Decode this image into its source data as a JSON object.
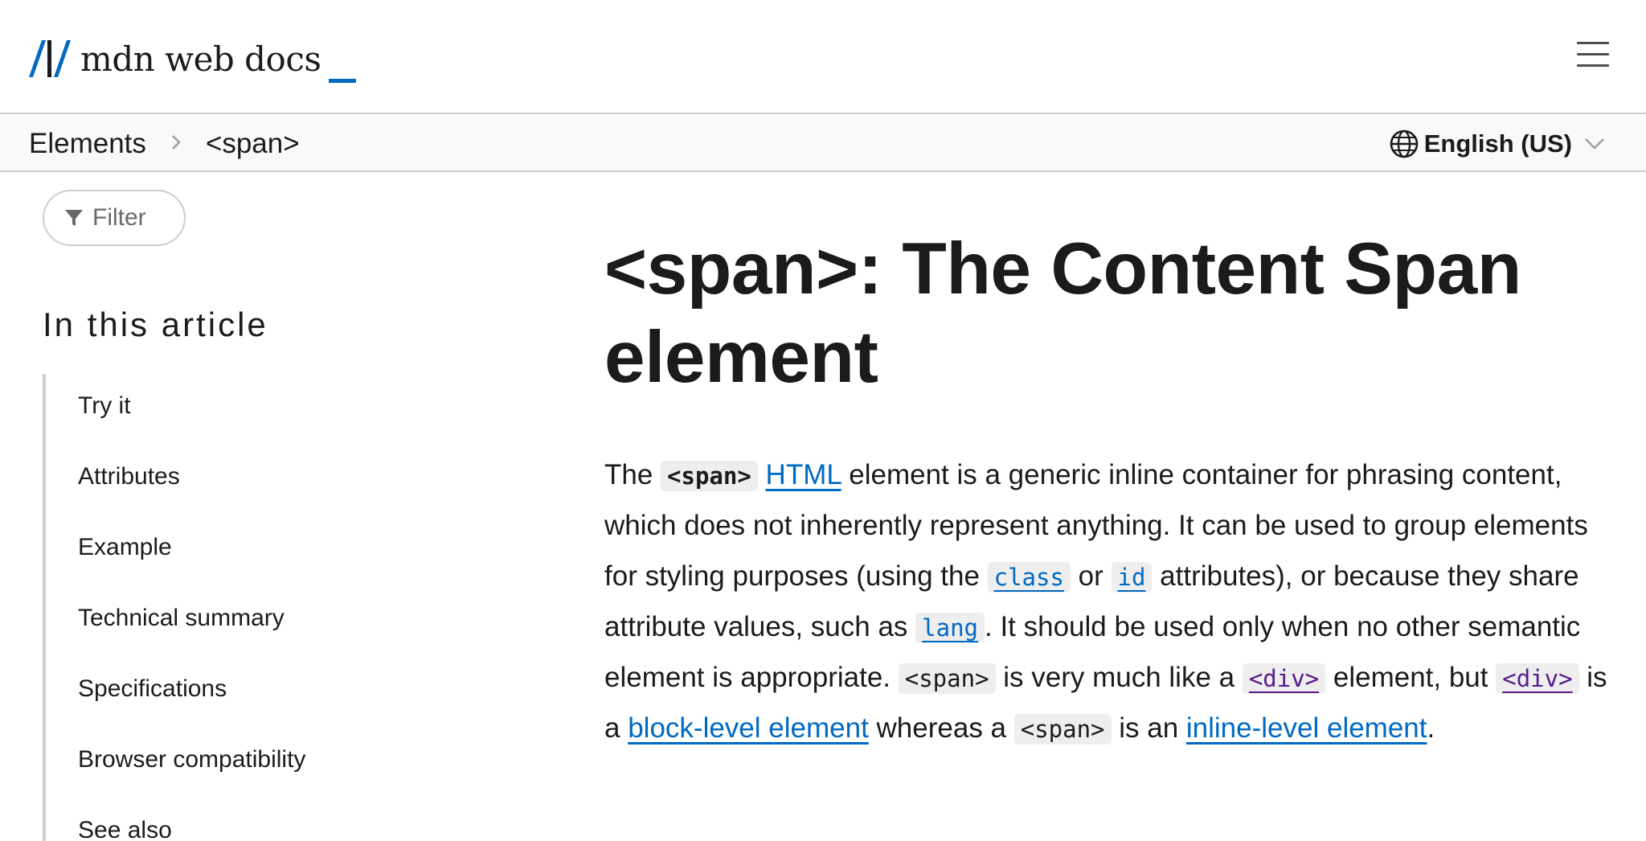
{
  "header": {
    "logo_text": "mdn web docs",
    "menu_icon": "hamburger-menu-icon",
    "accent_color": "#0069c2"
  },
  "breadcrumb": {
    "items": [
      "Elements",
      "<span>"
    ],
    "separator_icon": "chevron-right-icon"
  },
  "language": {
    "label": "English (US)",
    "icon": "globe-icon"
  },
  "sidebar": {
    "filter_placeholder": "Filter",
    "toc_title": "In this article",
    "toc_items": [
      "Try it",
      "Attributes",
      "Example",
      "Technical summary",
      "Specifications",
      "Browser compatibility",
      "See also"
    ]
  },
  "article": {
    "title": "<span>: The Content Span element",
    "p1_the": "The ",
    "p1_code_span": "<span>",
    "p1_link_html": "HTML",
    "p1_text1": " element is a generic inline container for phrasing content, which does not inherently represent anything. It can be used to group elements for styling purposes (using the ",
    "p1_code_class": "class",
    "p1_text2": " or ",
    "p1_code_id": "id",
    "p1_text3": " attributes), or because they share attribute values, such as ",
    "p1_code_lang": "lang",
    "p1_text4": ". It should be used only when no other semantic element is appropriate. ",
    "p1_code_span2": "<span>",
    "p1_text5": " is very much like a ",
    "p1_code_div1": "<div>",
    "p1_text6": " element, but ",
    "p1_code_div2": "<div>",
    "p1_text7": " is a ",
    "p1_link_block": "block-level element",
    "p1_text8": " whereas a ",
    "p1_code_span3": "<span>",
    "p1_text9": " is an ",
    "p1_link_inline": "inline-level element",
    "p1_text10": "."
  }
}
